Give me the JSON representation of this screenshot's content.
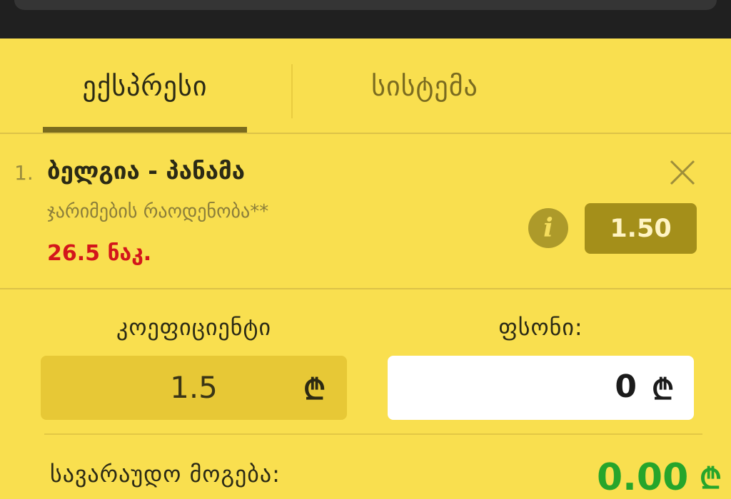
{
  "tabs": {
    "express": "ექსპრესი",
    "system": "სისტემა"
  },
  "bet": {
    "index": "1.",
    "match": "ბელგია - პანამა",
    "market": "ჯარიმების რაოდენობა**",
    "pick": "26.5 ნაკ.",
    "odd": "1.50"
  },
  "fields": {
    "coefficient_label": "კოეფიციენტი",
    "coefficient_value": "1.5",
    "stake_label": "ფსონი:",
    "stake_value": "0",
    "currency_symbol": "₾"
  },
  "summary": {
    "possible_win_label": "სავარაუდო მოგება:",
    "possible_win_value": "0.00",
    "currency_symbol": "₾"
  },
  "colors": {
    "background": "#f9df4f",
    "odd_badge": "#a48f1a",
    "pick_red": "#d3161b",
    "win_green": "#26a52b"
  }
}
